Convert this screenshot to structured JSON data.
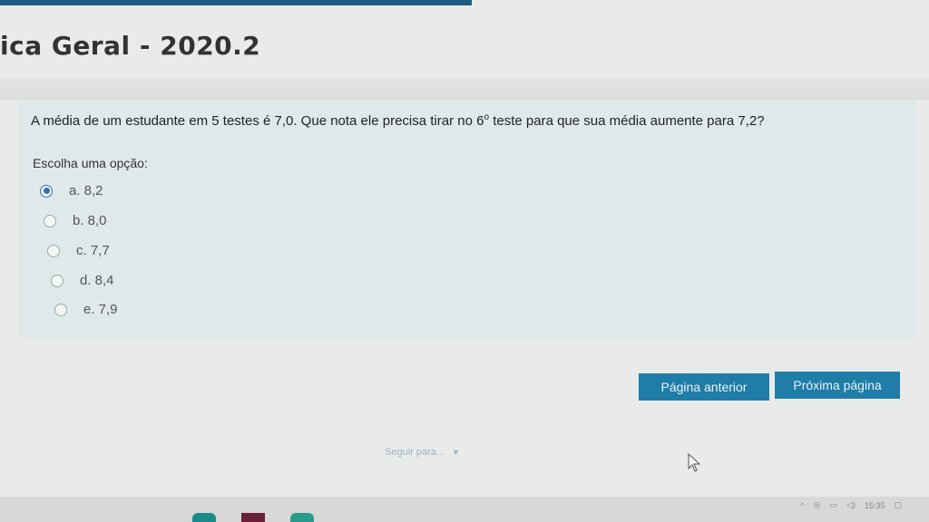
{
  "course": {
    "title": "ica Geral - 2020.2"
  },
  "question": {
    "text_before": "A média de um estudante em 5 testes é 7,0. Que nota ele precisa tirar no 6",
    "superscript": "o",
    "text_after": " teste para que sua média aumente para 7,2?",
    "choose_label": "Escolha uma opção:",
    "options": [
      {
        "label": "a. 8,2",
        "selected": true
      },
      {
        "label": "b. 8,0",
        "selected": false
      },
      {
        "label": "c. 7,7",
        "selected": false
      },
      {
        "label": "d. 8,4",
        "selected": false
      },
      {
        "label": "e. 7,9",
        "selected": false
      }
    ]
  },
  "navigation": {
    "prev_label": "Página anterior",
    "next_label": "Próxima página",
    "jump_label": "Seguir para..."
  },
  "colors": {
    "button": "#1f7da7",
    "radio_selected": "#2f6fb6",
    "question_bg": "#dfe9ea"
  },
  "taskbar": {
    "time": "15:35"
  }
}
